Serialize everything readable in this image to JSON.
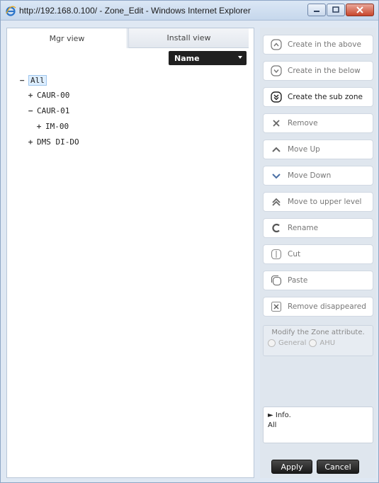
{
  "window": {
    "title": "http://192.168.0.100/ - Zone_Edit - Windows Internet Explorer"
  },
  "tabs": [
    {
      "label": "Mgr view",
      "active": true
    },
    {
      "label": "Install view",
      "active": false
    }
  ],
  "sort": {
    "selected": "Name"
  },
  "tree": [
    {
      "label": "All",
      "toggle": "−",
      "level": 0,
      "selected": true
    },
    {
      "label": "CAUR-00",
      "toggle": "+",
      "level": 1
    },
    {
      "label": "CAUR-01",
      "toggle": "−",
      "level": 1
    },
    {
      "label": "IM-00",
      "toggle": "+",
      "level": 2
    },
    {
      "label": "DMS DI-DO",
      "toggle": "+",
      "level": 1
    }
  ],
  "actions": [
    {
      "label": "Create in the above",
      "icon": "circle-up-icon"
    },
    {
      "label": "Create in the below",
      "icon": "circle-down-icon"
    },
    {
      "label": "Create the sub zone",
      "icon": "circle-double-down-icon"
    },
    {
      "label": "Remove",
      "icon": "x-icon"
    },
    {
      "label": "Move Up",
      "icon": "chevron-up-icon"
    },
    {
      "label": "Move Down",
      "icon": "chevron-down-icon"
    },
    {
      "label": "Move to upper level",
      "icon": "double-chevron-up-icon"
    },
    {
      "label": "Rename",
      "icon": "rename-icon"
    },
    {
      "label": "Cut",
      "icon": "cut-icon"
    },
    {
      "label": "Paste",
      "icon": "paste-icon"
    },
    {
      "label": "Remove disappeared",
      "icon": "boxed-x-icon"
    }
  ],
  "zone_attribute": {
    "title": "Modify the Zone attribute.",
    "options": [
      "General",
      "AHU"
    ]
  },
  "info": {
    "title": "► Info.",
    "value": "All"
  },
  "buttons": {
    "apply": "Apply",
    "cancel": "Cancel"
  }
}
